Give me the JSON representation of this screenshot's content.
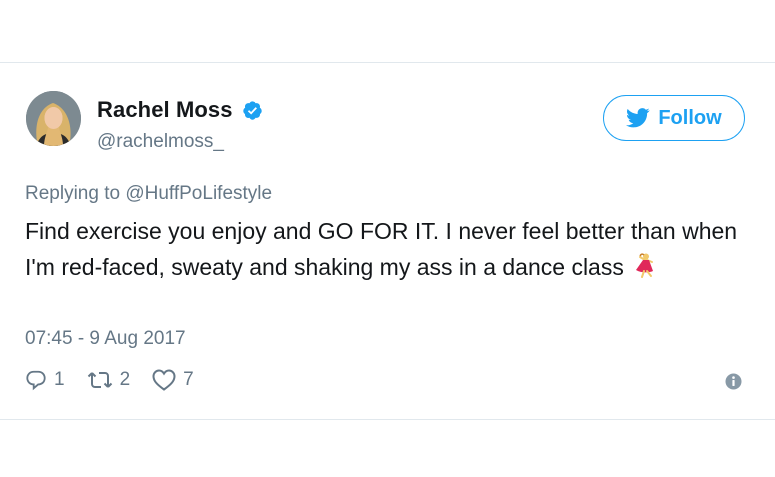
{
  "tweet": {
    "author_name": "Rachel Moss",
    "author_handle": "@rachelmoss_",
    "follow_label": "Follow",
    "replying_prefix": "Replying to ",
    "replying_to": "@HuffPoLifestyle",
    "text": "Find exercise you enjoy and GO FOR IT. I never feel better than when I'm red-faced, sweaty and shaking my ass in a dance class",
    "emoji": "dancer-emoji",
    "timestamp": "07:45 - 9 Aug 2017",
    "reply_count": "1",
    "retweet_count": "2",
    "like_count": "7"
  },
  "icons": {
    "verified": "verified-badge-icon",
    "bird": "twitter-bird-icon",
    "reply": "reply-icon",
    "retweet": "retweet-icon",
    "like": "heart-icon",
    "info": "info-icon"
  },
  "colors": {
    "twitter_blue": "#1da1f2",
    "text_primary": "#14171a",
    "text_secondary": "#657786",
    "border": "#e1e8ed"
  }
}
